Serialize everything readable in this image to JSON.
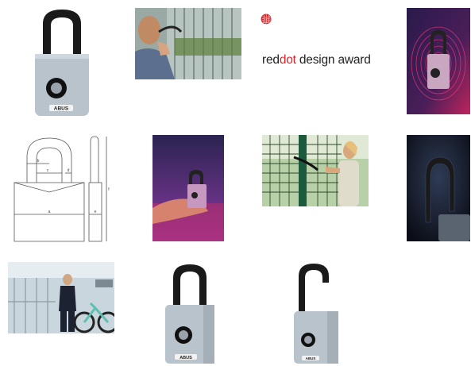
{
  "gallery": {
    "award": {
      "brand_part1": "red",
      "brand_part2": "dot",
      "brand_part3": " design award",
      "brand_color": "#d8232a"
    },
    "padlock_brand": "ABUS",
    "images": [
      {
        "subject": "padlock-front-silver"
      },
      {
        "subject": "woman-locking-bike-shed"
      },
      {
        "subject": "reddot-award-logo"
      },
      {
        "subject": "padlock-fingerprint-purple"
      },
      {
        "subject": "padlock-dimension-drawing"
      },
      {
        "subject": "hand-holding-padlock"
      },
      {
        "subject": "woman-locking-gate"
      },
      {
        "subject": "padlock-shackle-dark"
      },
      {
        "subject": "man-at-bike-garage"
      },
      {
        "subject": "padlock-front-angle"
      },
      {
        "subject": "padlock-open-shackle"
      }
    ],
    "dimension_labels": [
      "a",
      "b",
      "c",
      "d",
      "e",
      "f"
    ]
  }
}
